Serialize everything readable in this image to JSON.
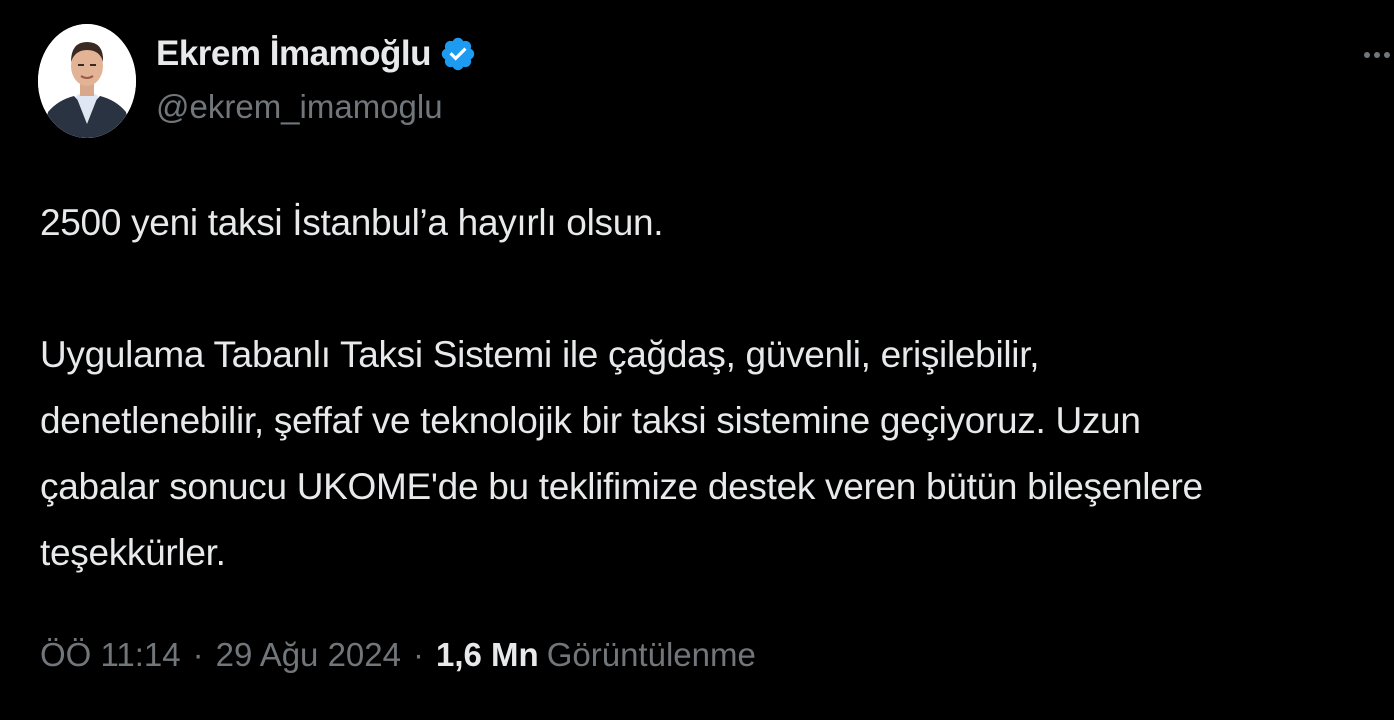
{
  "author": {
    "display_name": "Ekrem İmamoğlu",
    "handle": "@ekrem_imamoglu",
    "verified": true,
    "verified_color": "#1d9bf0"
  },
  "tweet": {
    "text_para1": "2500 yeni taksi İstanbul’a hayırlı olsun.",
    "text_para2_lines": [
      "Uygulama Tabanlı Taksi Sistemi ile çağdaş, güvenli, erişilebilir,",
      "denetlenebilir, şeffaf ve teknolojik bir taksi sistemine geçiyoruz. Uzun",
      "çabalar sonucu UKOME'de bu teklifimize destek veren bütün bileşenlere",
      "teşekkürler."
    ]
  },
  "meta": {
    "time": "ÖÖ 11:14",
    "separator": "·",
    "date": "29 Ağu 2024",
    "views_count": "1,6 Mn",
    "views_label": "Görüntülenme"
  },
  "icons": {
    "more": "more-icon",
    "verified": "verified-badge-icon"
  },
  "colors": {
    "background": "#000000",
    "text_primary": "#e7e9ea",
    "text_secondary": "#71767b",
    "accent": "#1d9bf0"
  }
}
